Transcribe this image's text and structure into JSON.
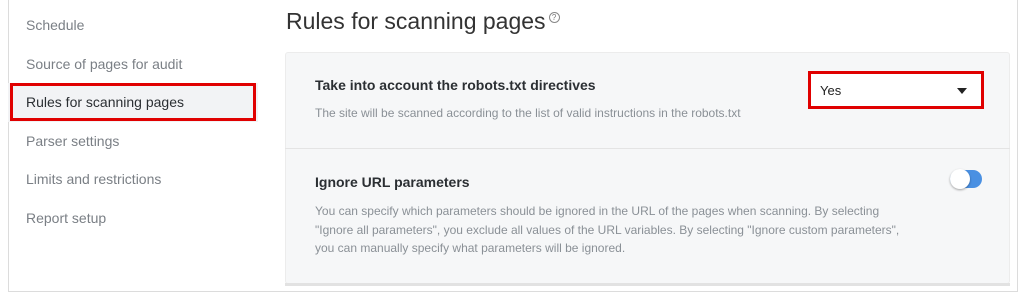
{
  "sidebar": {
    "items": [
      {
        "label": "Schedule"
      },
      {
        "label": "Source of pages for audit"
      },
      {
        "label": "Rules for scanning pages"
      },
      {
        "label": "Parser settings"
      },
      {
        "label": "Limits and restrictions"
      },
      {
        "label": "Report setup"
      }
    ],
    "active_index": 2
  },
  "page": {
    "title": "Rules for scanning pages",
    "help_glyph": "?"
  },
  "settings": {
    "robots": {
      "title": "Take into account the robots.txt directives",
      "description": "The site will be scanned according to the list of valid instructions in the robots.txt",
      "select_value": "Yes"
    },
    "url_params": {
      "title": "Ignore URL parameters",
      "description_lines": [
        "You can specify which parameters should be ignored in the URL of the pages when scanning. By selecting",
        "\"Ignore all parameters\", you exclude all values of the URL variables. By selecting \"Ignore custom parameters\",",
        "you can manually specify what parameters will be ignored."
      ],
      "toggle_on": false
    }
  },
  "colors": {
    "highlight": "#e00000",
    "toggle_track": "#4a90e2"
  },
  "icons": {
    "help": "help-circle-icon",
    "dropdown": "caret-down-icon"
  }
}
